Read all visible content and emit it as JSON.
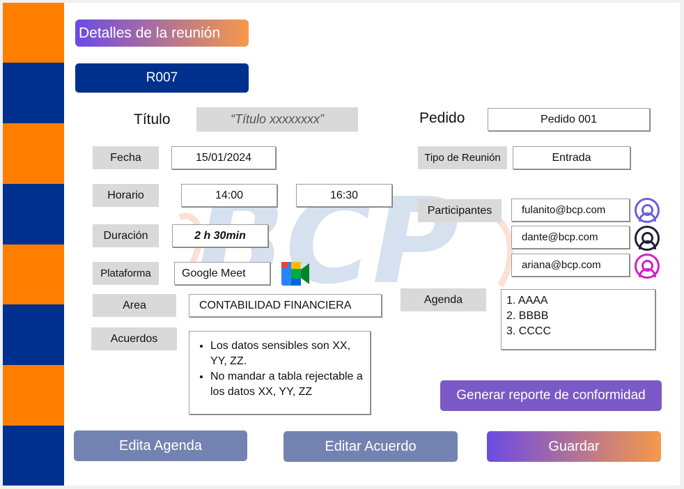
{
  "header": {
    "title": "Detalles de la reunión",
    "meeting_id": "R007"
  },
  "watermark": {
    "text": "BCP"
  },
  "form": {
    "titulo": {
      "label": "Título",
      "value": "“Título xxxxxxxx”"
    },
    "pedido": {
      "label": "Pedido",
      "value": "Pedido 001"
    },
    "fecha": {
      "label": "Fecha",
      "value": "15/01/2024"
    },
    "tipo_reunion": {
      "label": "Tipo de Reunión",
      "value": "Entrada"
    },
    "horario": {
      "label": "Horario",
      "start": "14:00",
      "end": "16:30"
    },
    "duracion": {
      "label": "Duración",
      "value": "2 h 30min"
    },
    "plataforma": {
      "label": "Plataforma",
      "value": "Google Meet",
      "icon": "google-meet-icon"
    },
    "area": {
      "label": "Area",
      "value": "CONTABILIDAD FINANCIERA"
    },
    "acuerdos": {
      "label": "Acuerdos",
      "items": [
        "Los datos sensibles son XX, YY, ZZ.",
        "No mandar a tabla rejectable a los datos XX, YY, ZZ"
      ]
    },
    "participantes": {
      "label": "Participantes",
      "list": [
        {
          "email": "fulanito@bcp.com",
          "icon": "user-avatar-icon",
          "color": "#6a5fe0"
        },
        {
          "email": "dante@bcp.com",
          "icon": "user-avatar-icon",
          "color": "#1f1f3a"
        },
        {
          "email": "ariana@bcp.com",
          "icon": "user-avatar-icon",
          "color": "#d21fc8"
        }
      ]
    },
    "agenda": {
      "label": "Agenda",
      "items": [
        "1. AAAA",
        "2. BBBB",
        "3. CCCC"
      ]
    }
  },
  "actions": {
    "report": "Generar reporte de conformidad",
    "edit_agenda": "Edita Agenda",
    "edit_agreement": "Editar Acuerdo",
    "save": "Guardar"
  },
  "colors": {
    "orange": "#ff7e00",
    "navy": "#00308e",
    "slate_button": "#7383b1",
    "purple_button": "#7b59c7",
    "gradient_start": "#6b4be4",
    "gradient_end": "#f5994a"
  }
}
